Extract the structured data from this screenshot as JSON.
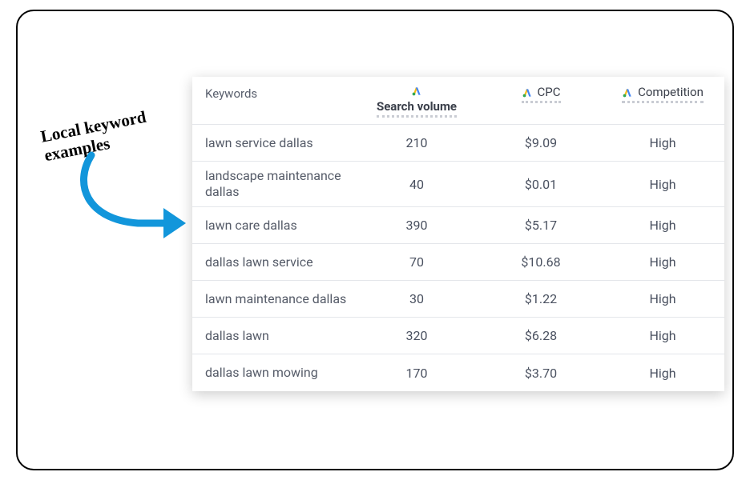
{
  "annotation_text": "Local keyword\nexamples",
  "headers": {
    "keywords": "Keywords",
    "search_volume": "Search volume",
    "cpc": "CPC",
    "competition": "Competition"
  },
  "rows": [
    {
      "keyword": "lawn service dallas",
      "search_volume": "210",
      "cpc": "$9.09",
      "competition": "High"
    },
    {
      "keyword": "landscape maintenance dallas",
      "search_volume": "40",
      "cpc": "$0.01",
      "competition": "High"
    },
    {
      "keyword": "lawn care dallas",
      "search_volume": "390",
      "cpc": "$5.17",
      "competition": "High"
    },
    {
      "keyword": "dallas lawn service",
      "search_volume": "70",
      "cpc": "$10.68",
      "competition": "High"
    },
    {
      "keyword": "lawn maintenance dallas",
      "search_volume": "30",
      "cpc": "$1.22",
      "competition": "High"
    },
    {
      "keyword": "dallas lawn",
      "search_volume": "320",
      "cpc": "$6.28",
      "competition": "High"
    },
    {
      "keyword": "dallas lawn mowing",
      "search_volume": "170",
      "cpc": "$3.70",
      "competition": "High"
    }
  ]
}
